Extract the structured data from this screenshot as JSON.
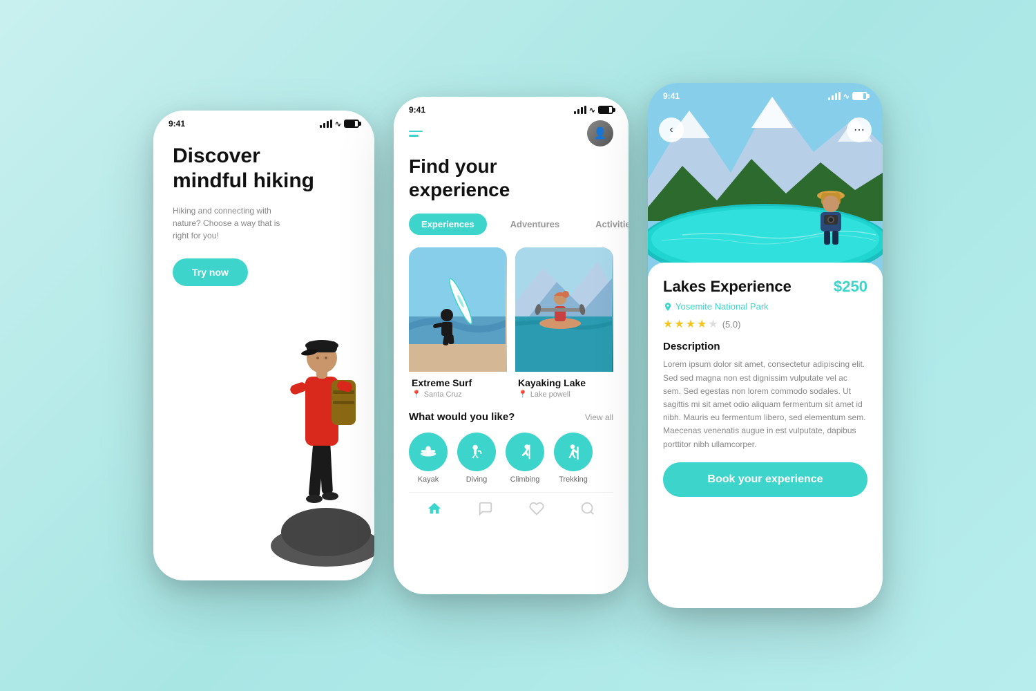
{
  "background": {
    "color": "#b8edeb"
  },
  "screen1": {
    "status_time": "9:41",
    "title_line1": "Discover",
    "title_line2": "mindful hiking",
    "subtitle": "Hiking and connecting with nature? Choose a way that is right for you!",
    "cta_button": "Try now"
  },
  "screen2": {
    "status_time": "9:41",
    "title_line1": "Find your",
    "title_line2": "experience",
    "tabs": [
      {
        "label": "Experiences",
        "active": true
      },
      {
        "label": "Adventures",
        "active": false
      },
      {
        "label": "Activities",
        "active": false
      }
    ],
    "cards": [
      {
        "title": "Extreme Surf",
        "location": "Santa Cruz"
      },
      {
        "title": "Kayaking Lake",
        "location": "Lake powell"
      }
    ],
    "section_title": "What would you like?",
    "view_all_label": "View all",
    "activities": [
      {
        "label": "Kayak",
        "icon": "🚣"
      },
      {
        "label": "Diving",
        "icon": "🤿"
      },
      {
        "label": "Climbing",
        "icon": "🧗"
      },
      {
        "label": "Trekking",
        "icon": "🥾"
      }
    ]
  },
  "screen3": {
    "status_time": "9:41",
    "title": "Lakes Experience",
    "price": "$250",
    "location": "Yosemite National Park",
    "rating": "5.0",
    "rating_display": "(5.0)",
    "filled_stars": 4,
    "empty_stars": 1,
    "description_title": "Description",
    "description_text": "Lorem ipsum dolor sit amet, consectetur adipiscing elit. Sed sed magna non est dignissim vulputate vel ac sem. Sed egestas non lorem commodo sodales. Ut sagittis mi sit amet odio aliquam fermentum sit amet id nibh. Mauris eu fermentum libero, sed elementum sem. Maecenas venenatis augue in est vulputate, dapibus porttitor nibh ullamcorper.",
    "book_button": "Book your experience"
  }
}
